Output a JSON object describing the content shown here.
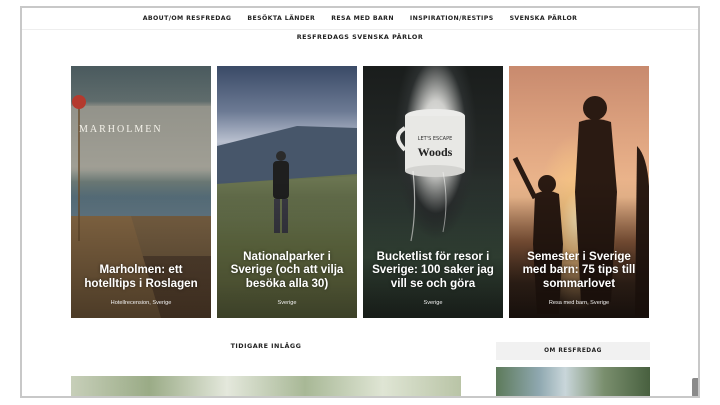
{
  "nav": {
    "items": [
      "ABOUT/OM RESFREDAG",
      "BESÖKTA LÄNDER",
      "RESA MED BARN",
      "INSPIRATION/RESTIPS",
      "SVENSKA PÄRLOR"
    ]
  },
  "section": {
    "title": "RESFREDAGS SVENSKA PÄRLOR"
  },
  "cards": [
    {
      "title": "Marholmen: ett hotelltips i Roslagen",
      "categories": "Hotellrecension, Sverige",
      "photo_text": "MARHOLMEN"
    },
    {
      "title": "Nationalparker i Sverige (och att vilja besöka alla 30)",
      "categories": "Sverige"
    },
    {
      "title": "Bucketlist för resor i Sverige: 100 saker jag vill se och göra",
      "categories": "Sverige",
      "photo_text_top": "LET'S ESCAPE",
      "photo_text_bottom": "Woods"
    },
    {
      "title": "Semester i Sverige med barn: 75 tips till sommarlovet",
      "categories": "Resa med barn, Sverige"
    }
  ],
  "lower": {
    "earlier_title": "TIDIGARE INLÄGG",
    "sidebar_title": "OM RESFREDAG"
  },
  "scroll_top": {
    "icon": "arrow-up-icon",
    "glyph": "↑"
  }
}
